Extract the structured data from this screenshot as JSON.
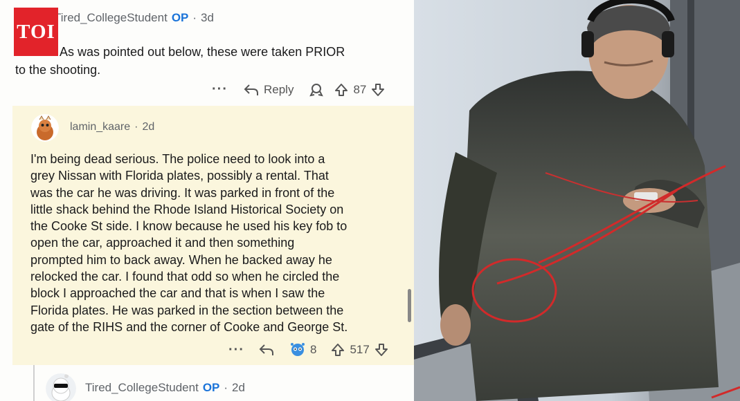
{
  "brand": {
    "logo_text": "TOI",
    "color": "#e2232a"
  },
  "comments": [
    {
      "author": "Tired_CollegeStudent",
      "op_badge": "OP",
      "time": "3d",
      "line1": "As was pointed out below, these were taken PRIOR",
      "line2": "to the shooting.",
      "reply_label": "Reply",
      "score": "87"
    },
    {
      "author": "lamin_kaare",
      "time": "2d",
      "lines": [
        "I'm being dead serious. The police need to look into a",
        "grey Nissan with Florida plates, possibly a rental. That",
        "was the car he was driving. It was parked in front of the",
        "little shack behind the Rhode Island Historical Society on",
        "the Cooke St side. I know because he used his key fob to",
        "open the car, approached it and then something",
        "prompted him to back away. When he backed away he",
        "relocked the car. I found that odd so when he circled the",
        "block I approached the car and that is when I saw the",
        "Florida plates. He was parked in the section between the",
        "gate of the RIHS and the corner of Cooke and George St."
      ],
      "award_count": "8",
      "score": "517"
    },
    {
      "author": "Tired_CollegeStudent",
      "op_badge": "OP",
      "time": "2d"
    }
  ],
  "colors": {
    "highlight": "#fbf6dd",
    "op": "#1a73d9",
    "text": "#1a1a1b",
    "meta": "#5f6368"
  },
  "icons": [
    "more-icon",
    "reply-icon",
    "award-icon",
    "upvote-icon",
    "downvote-icon",
    "avatar-icon"
  ],
  "photo": {
    "subject": "man-with-headphones-holding-phone",
    "annotation": "red-circle-markings"
  }
}
